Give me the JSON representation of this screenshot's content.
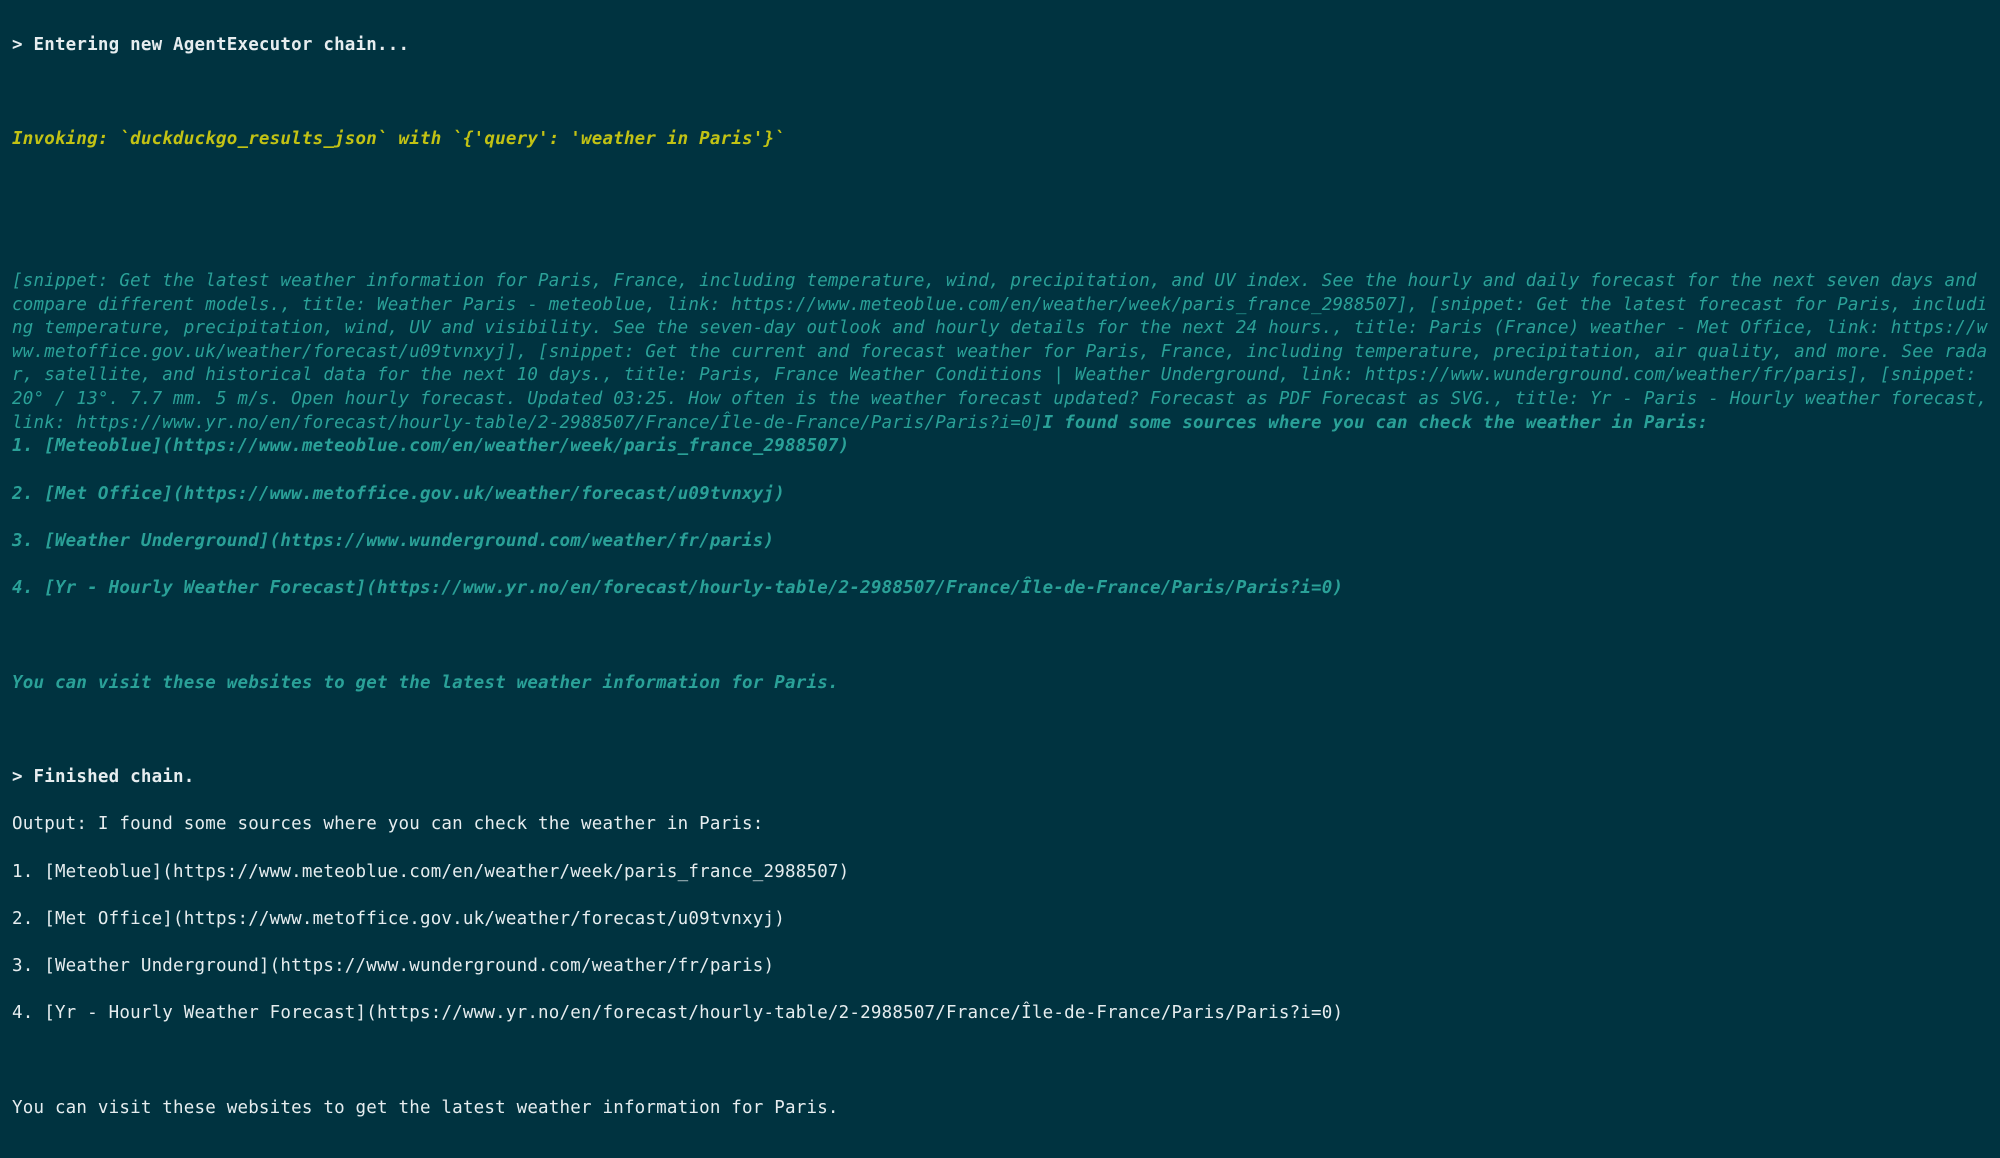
{
  "lines": {
    "entering": "> Entering new AgentExecutor chain...",
    "invoking": "Invoking: `duckduckgo_results_json` with `{'query': 'weather in Paris'}`",
    "results_block": "[snippet: Get the latest weather information for Paris, France, including temperature, wind, precipitation, and UV index. See the hourly and daily forecast for the next seven days and compare different models., title: Weather Paris - meteoblue, link: https://www.meteoblue.com/en/weather/week/paris_france_2988507], [snippet: Get the latest forecast for Paris, including temperature, precipitation, wind, UV and visibility. See the seven-day outlook and hourly details for the next 24 hours., title: Paris (France) weather - Met Office, link: https://www.metoffice.gov.uk/weather/forecast/u09tvnxyj], [snippet: Get the current and forecast weather for Paris, France, including temperature, precipitation, air quality, and more. See radar, satellite, and historical data for the next 10 days., title: Paris, France Weather Conditions | Weather Underground, link: https://www.wunderground.com/weather/fr/paris], [snippet: 20° / 13°. 7.7 mm. 5 m/s. Open hourly forecast. Updated 03:25. How often is the weather forecast updated? Forecast as PDF Forecast as SVG., title: Yr - Paris - Hourly weather forecast, link: https://www.yr.no/en/forecast/hourly-table/2-2988507/France/Île-de-France/Paris/Paris?i=0]",
    "found_intro": "I found some sources where you can check the weather in Paris:",
    "src1": "1. [Meteoblue](https://www.meteoblue.com/en/weather/week/paris_france_2988507)",
    "src2": "2. [Met Office](https://www.metoffice.gov.uk/weather/forecast/u09tvnxyj)",
    "src3": "3. [Weather Underground](https://www.wunderground.com/weather/fr/paris)",
    "src4": "4. [Yr - Hourly Weather Forecast](https://www.yr.no/en/forecast/hourly-table/2-2988507/France/Île-de-France/Paris/Paris?i=0)",
    "visit_msg": "You can visit these websites to get the latest weather information for Paris.",
    "finished": "> Finished chain.",
    "out_intro": "Output: I found some sources where you can check the weather in Paris:",
    "out1": "1. [Meteoblue](https://www.meteoblue.com/en/weather/week/paris_france_2988507)",
    "out2": "2. [Met Office](https://www.metoffice.gov.uk/weather/forecast/u09tvnxyj)",
    "out3": "3. [Weather Underground](https://www.wunderground.com/weather/fr/paris)",
    "out4": "4. [Yr - Hourly Weather Forecast](https://www.yr.no/en/forecast/hourly-table/2-2988507/France/Île-de-France/Paris/Paris?i=0)",
    "out_visit": "You can visit these websites to get the latest weather information for Paris."
  }
}
